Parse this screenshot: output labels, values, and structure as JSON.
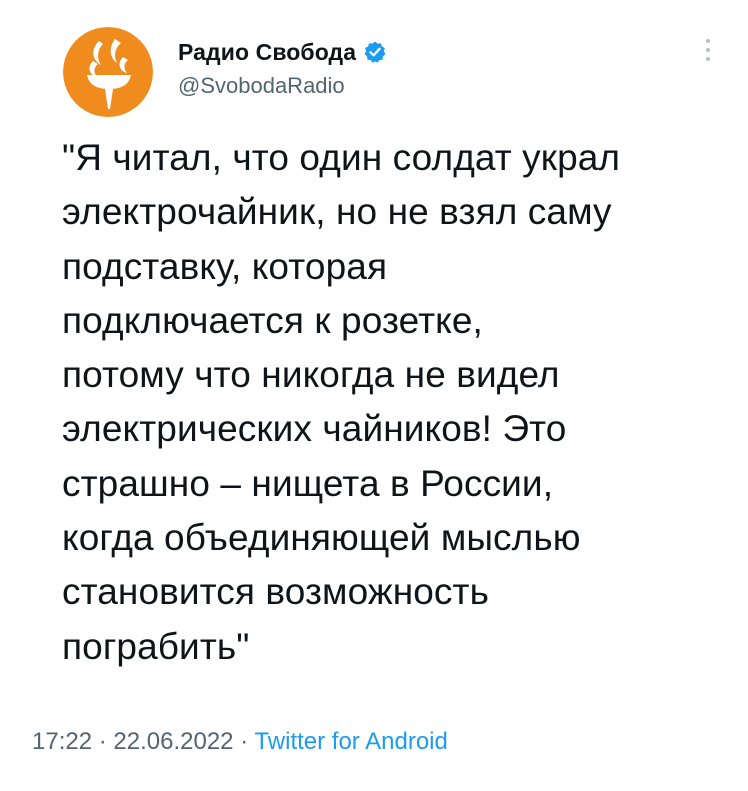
{
  "tweet": {
    "author": {
      "name": "Радио Свобода",
      "handle": "@SvobodaRadio",
      "verified": true,
      "avatar_icon": "rfe-rl-torch-logo",
      "avatar_color": "#f08c1e"
    },
    "more_icon": "vertical-ellipsis-icon",
    "text": "\"Я читал, что один солдат украл\nэлектрочайник, но не взял саму\nподставку, которая\nподключается к розетке,\nпотому что никогда не видел\nэлектрических чайников! Это\nстрашно – нищета в России,\nкогда объединяющей мыслью\nстановится возможность\nпограбить\"",
    "time": "17:22",
    "separator": "·",
    "date": "22.06.2022",
    "source": "Twitter for Android",
    "accent_color": "#1d9bf0"
  }
}
